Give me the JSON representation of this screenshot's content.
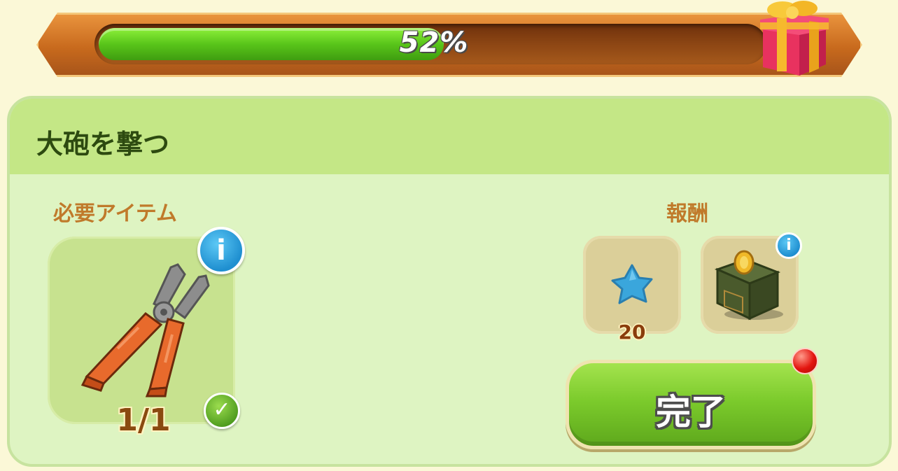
{
  "progress": {
    "percent_label": "52%",
    "fraction": 0.52
  },
  "task": {
    "title": "大砲を撃つ"
  },
  "required": {
    "label": "必要アイテム",
    "item_icon": "pliers-icon",
    "count": "1/1",
    "info_icon": "info-icon",
    "check_icon": "checkmark-icon"
  },
  "rewards": {
    "label": "報酬",
    "items": [
      {
        "icon": "blue-star-icon",
        "count": "20"
      },
      {
        "icon": "mystery-box-icon"
      }
    ]
  },
  "complete_button": {
    "label": "完了"
  },
  "colors": {
    "accent_green": "#7ccb2c",
    "header_green": "#c4e786",
    "label_brown": "#c07a2b"
  }
}
